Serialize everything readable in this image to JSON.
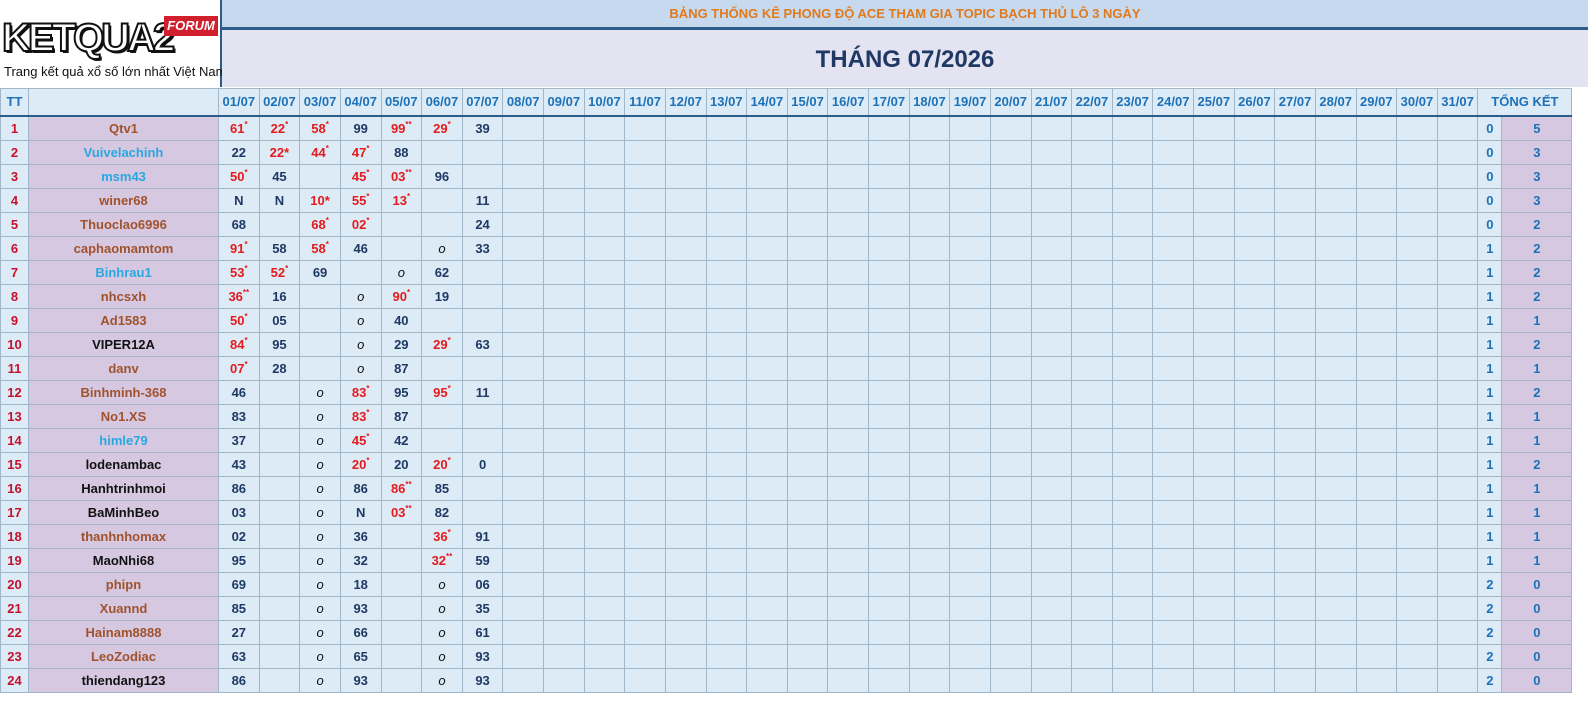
{
  "logo": {
    "brand": "KETQUA2",
    "badge": "FORUM",
    "tagline": "Trang kết quả xổ số lớn nhất Việt Nam"
  },
  "banner": "BẢNG THỐNG KÊ PHONG ĐỘ ACE THAM GIA TOPIC BẠCH THỦ LÔ 3 NGÀY",
  "month_title": "THÁNG 07/2026",
  "headers": {
    "tt": "TT",
    "total": "TỔNG KẾT",
    "days": [
      "01/07",
      "02/07",
      "03/07",
      "04/07",
      "05/07",
      "06/07",
      "07/07",
      "08/07",
      "09/07",
      "10/07",
      "11/07",
      "12/07",
      "13/07",
      "14/07",
      "15/07",
      "16/07",
      "17/07",
      "18/07",
      "19/07",
      "20/07",
      "21/07",
      "22/07",
      "23/07",
      "24/07",
      "25/07",
      "26/07",
      "27/07",
      "28/07",
      "29/07",
      "30/07",
      "31/07"
    ]
  },
  "colors": {
    "orange_name": "#a0522d",
    "blue_name": "#2aa7e0",
    "black_name": "#111111",
    "win_red": "#e41a1c",
    "border": "#2b5c8a"
  },
  "rows": [
    {
      "tt": "1",
      "name": "Qtv1",
      "color": "orange",
      "cells": [
        [
          "61",
          "*"
        ],
        [
          "22",
          "*"
        ],
        [
          "58",
          "*"
        ],
        [
          "99",
          ""
        ],
        [
          "99",
          "**"
        ],
        [
          "29",
          "*"
        ],
        [
          "39",
          ""
        ]
      ],
      "totals": [
        "0",
        "5"
      ]
    },
    {
      "tt": "2",
      "name": "Vuivelachinh",
      "color": "blue",
      "cells": [
        [
          "22",
          ""
        ],
        [
          "22*",
          "txt"
        ],
        [
          "44",
          "*"
        ],
        [
          "47",
          "*"
        ],
        [
          "88",
          ""
        ],
        [
          "",
          ""
        ],
        [
          "",
          ""
        ]
      ],
      "totals": [
        "0",
        "3"
      ]
    },
    {
      "tt": "3",
      "name": "msm43",
      "color": "blue",
      "cells": [
        [
          "50",
          "*"
        ],
        [
          "45",
          ""
        ],
        [
          "",
          ""
        ],
        [
          "45",
          "*"
        ],
        [
          "03",
          "**"
        ],
        [
          "96",
          ""
        ],
        [
          "",
          ""
        ]
      ],
      "totals": [
        "0",
        "3"
      ]
    },
    {
      "tt": "4",
      "name": "winer68",
      "color": "orange",
      "cells": [
        [
          "N",
          ""
        ],
        [
          "N",
          ""
        ],
        [
          "10*",
          "txt"
        ],
        [
          "55",
          "*"
        ],
        [
          "13",
          "*"
        ],
        [
          "",
          ""
        ],
        [
          "11",
          ""
        ]
      ],
      "totals": [
        "0",
        "3"
      ]
    },
    {
      "tt": "5",
      "name": "Thuoclao6996",
      "color": "orange",
      "cells": [
        [
          "68",
          ""
        ],
        [
          "",
          ""
        ],
        [
          "68",
          "*"
        ],
        [
          "02",
          "*"
        ],
        [
          "",
          ""
        ],
        [
          "",
          ""
        ],
        [
          "24",
          ""
        ]
      ],
      "totals": [
        "0",
        "2"
      ]
    },
    {
      "tt": "6",
      "name": "caphaomamtom",
      "color": "orange",
      "cells": [
        [
          "91",
          "*"
        ],
        [
          "58",
          ""
        ],
        [
          "58",
          "*"
        ],
        [
          "46",
          ""
        ],
        [
          "",
          ""
        ],
        [
          "o",
          "i"
        ],
        [
          "33",
          ""
        ]
      ],
      "totals": [
        "1",
        "2"
      ]
    },
    {
      "tt": "7",
      "name": "Binhrau1",
      "color": "blue",
      "cells": [
        [
          "53",
          "*"
        ],
        [
          "52",
          "*"
        ],
        [
          "69",
          ""
        ],
        [
          "",
          ""
        ],
        [
          "o",
          "i"
        ],
        [
          "62",
          ""
        ],
        [
          "",
          ""
        ]
      ],
      "totals": [
        "1",
        "2"
      ]
    },
    {
      "tt": "8",
      "name": "nhcsxh",
      "color": "orange",
      "cells": [
        [
          "36",
          "**"
        ],
        [
          "16",
          ""
        ],
        [
          "",
          ""
        ],
        [
          "o",
          "i"
        ],
        [
          "90",
          "*"
        ],
        [
          "19",
          ""
        ],
        [
          "",
          ""
        ]
      ],
      "totals": [
        "1",
        "2"
      ]
    },
    {
      "tt": "9",
      "name": "Ad1583",
      "color": "orange",
      "cells": [
        [
          "50",
          "*"
        ],
        [
          "05",
          ""
        ],
        [
          "",
          ""
        ],
        [
          "o",
          "i"
        ],
        [
          "40",
          ""
        ],
        [
          "",
          ""
        ],
        [
          "",
          ""
        ]
      ],
      "totals": [
        "1",
        "1"
      ]
    },
    {
      "tt": "10",
      "name": "VIPER12A",
      "color": "black",
      "cells": [
        [
          "84",
          "*"
        ],
        [
          "95",
          ""
        ],
        [
          "",
          ""
        ],
        [
          "o",
          "i"
        ],
        [
          "29",
          ""
        ],
        [
          "29",
          "*"
        ],
        [
          "63",
          ""
        ]
      ],
      "totals": [
        "1",
        "2"
      ]
    },
    {
      "tt": "11",
      "name": "danv",
      "color": "orange",
      "cells": [
        [
          "07",
          "*"
        ],
        [
          "28",
          ""
        ],
        [
          "",
          ""
        ],
        [
          "o",
          "i"
        ],
        [
          "87",
          ""
        ],
        [
          "",
          ""
        ],
        [
          "",
          ""
        ]
      ],
      "totals": [
        "1",
        "1"
      ]
    },
    {
      "tt": "12",
      "name": "Binhminh-368",
      "color": "orange",
      "cells": [
        [
          "46",
          ""
        ],
        [
          "",
          ""
        ],
        [
          "o",
          "i"
        ],
        [
          "83",
          "*"
        ],
        [
          "95",
          ""
        ],
        [
          "95",
          "*"
        ],
        [
          "11",
          ""
        ]
      ],
      "totals": [
        "1",
        "2"
      ]
    },
    {
      "tt": "13",
      "name": "No1.XS",
      "color": "orange",
      "cells": [
        [
          "83",
          ""
        ],
        [
          "",
          ""
        ],
        [
          "o",
          "i"
        ],
        [
          "83",
          "*"
        ],
        [
          "87",
          ""
        ],
        [
          "",
          ""
        ],
        [
          "",
          ""
        ]
      ],
      "totals": [
        "1",
        "1"
      ]
    },
    {
      "tt": "14",
      "name": "himle79",
      "color": "blue",
      "cells": [
        [
          "37",
          ""
        ],
        [
          "",
          ""
        ],
        [
          "o",
          "i"
        ],
        [
          "45",
          "*"
        ],
        [
          "42",
          ""
        ],
        [
          "",
          ""
        ],
        [
          "",
          ""
        ]
      ],
      "totals": [
        "1",
        "1"
      ]
    },
    {
      "tt": "15",
      "name": "lodenambac",
      "color": "black",
      "cells": [
        [
          "43",
          ""
        ],
        [
          "",
          ""
        ],
        [
          "o",
          "i"
        ],
        [
          "20",
          "*"
        ],
        [
          "20",
          ""
        ],
        [
          "20",
          "*"
        ],
        [
          "0",
          ""
        ]
      ],
      "totals": [
        "1",
        "2"
      ]
    },
    {
      "tt": "16",
      "name": "Hanhtrinhmoi",
      "color": "black",
      "cells": [
        [
          "86",
          ""
        ],
        [
          "",
          ""
        ],
        [
          "o",
          "i"
        ],
        [
          "86",
          ""
        ],
        [
          "86",
          "**"
        ],
        [
          "85",
          ""
        ],
        [
          "",
          ""
        ]
      ],
      "totals": [
        "1",
        "1"
      ]
    },
    {
      "tt": "17",
      "name": "BaMinhBeo",
      "color": "black",
      "cells": [
        [
          "03",
          ""
        ],
        [
          "",
          ""
        ],
        [
          "o",
          "i"
        ],
        [
          "N",
          ""
        ],
        [
          "03",
          "**"
        ],
        [
          "82",
          ""
        ],
        [
          "",
          ""
        ]
      ],
      "totals": [
        "1",
        "1"
      ]
    },
    {
      "tt": "18",
      "name": "thanhnhomax",
      "color": "orange",
      "cells": [
        [
          "02",
          ""
        ],
        [
          "",
          ""
        ],
        [
          "o",
          "i"
        ],
        [
          "36",
          ""
        ],
        [
          "",
          ""
        ],
        [
          "36",
          "*"
        ],
        [
          "91",
          ""
        ]
      ],
      "totals": [
        "1",
        "1"
      ]
    },
    {
      "tt": "19",
      "name": "MaoNhi68",
      "color": "black",
      "cells": [
        [
          "95",
          ""
        ],
        [
          "",
          ""
        ],
        [
          "o",
          "i"
        ],
        [
          "32",
          ""
        ],
        [
          "",
          ""
        ],
        [
          "32",
          "**"
        ],
        [
          "59",
          ""
        ]
      ],
      "totals": [
        "1",
        "1"
      ]
    },
    {
      "tt": "20",
      "name": "phipn",
      "color": "orange",
      "cells": [
        [
          "69",
          ""
        ],
        [
          "",
          ""
        ],
        [
          "o",
          "i"
        ],
        [
          "18",
          ""
        ],
        [
          "",
          ""
        ],
        [
          "o",
          "i"
        ],
        [
          "06",
          ""
        ]
      ],
      "totals": [
        "2",
        "0"
      ]
    },
    {
      "tt": "21",
      "name": "Xuannd",
      "color": "orange",
      "cells": [
        [
          "85",
          ""
        ],
        [
          "",
          ""
        ],
        [
          "o",
          "i"
        ],
        [
          "93",
          ""
        ],
        [
          "",
          ""
        ],
        [
          "o",
          "i"
        ],
        [
          "35",
          ""
        ]
      ],
      "totals": [
        "2",
        "0"
      ]
    },
    {
      "tt": "22",
      "name": "Hainam8888",
      "color": "orange",
      "cells": [
        [
          "27",
          ""
        ],
        [
          "",
          ""
        ],
        [
          "o",
          "i"
        ],
        [
          "66",
          ""
        ],
        [
          "",
          ""
        ],
        [
          "o",
          "i"
        ],
        [
          "61",
          ""
        ]
      ],
      "totals": [
        "2",
        "0"
      ]
    },
    {
      "tt": "23",
      "name": "LeoZodiac",
      "color": "orange",
      "cells": [
        [
          "63",
          ""
        ],
        [
          "",
          ""
        ],
        [
          "o",
          "i"
        ],
        [
          "65",
          ""
        ],
        [
          "",
          ""
        ],
        [
          "o",
          "i"
        ],
        [
          "93",
          ""
        ]
      ],
      "totals": [
        "2",
        "0"
      ]
    },
    {
      "tt": "24",
      "name": "thiendang123",
      "color": "black",
      "cells": [
        [
          "86",
          ""
        ],
        [
          "",
          ""
        ],
        [
          "o",
          "i"
        ],
        [
          "93",
          ""
        ],
        [
          "",
          ""
        ],
        [
          "o",
          "i"
        ],
        [
          "93",
          ""
        ]
      ],
      "totals": [
        "2",
        "0"
      ]
    }
  ]
}
